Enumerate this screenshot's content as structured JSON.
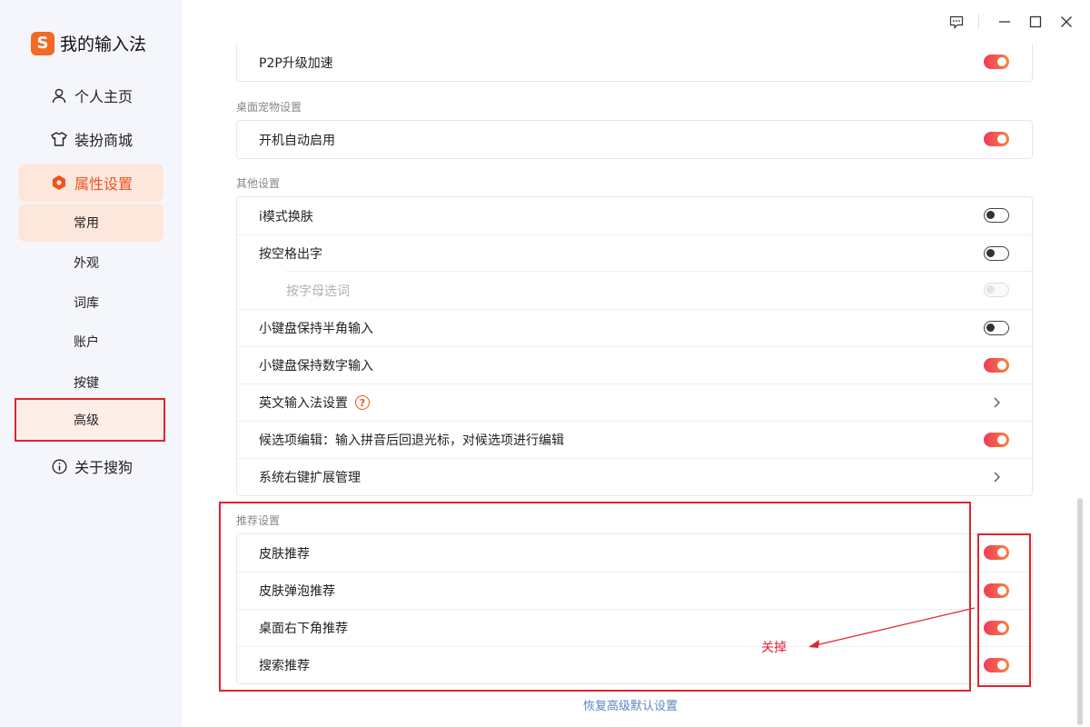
{
  "app": {
    "title": "我的输入法",
    "logo_letter": "S",
    "accent": "#f0521e"
  },
  "sidebar": {
    "nav": [
      {
        "label": "个人主页",
        "icon": "person-icon"
      },
      {
        "label": "装扮商城",
        "icon": "shirt-icon"
      },
      {
        "label": "属性设置",
        "icon": "hexagon-settings-icon"
      }
    ],
    "sub_items": [
      "常用",
      "外观",
      "词库",
      "账户",
      "按键",
      "高级"
    ],
    "about": {
      "label": "关于搜狗",
      "icon": "info-icon"
    }
  },
  "sections": {
    "p2p": {
      "label": "P2P升级加速",
      "on": true
    },
    "pet": {
      "title": "桌面宠物设置",
      "row": {
        "label": "开机自动启用",
        "on": true
      }
    },
    "other": {
      "title": "其他设置",
      "rows": [
        {
          "label": "i模式换肤",
          "state": "off"
        },
        {
          "label": "按空格出字",
          "state": "off"
        },
        {
          "label": "按字母选词",
          "state": "disabled"
        },
        {
          "label": "小键盘保持半角输入",
          "state": "off"
        },
        {
          "label": "小键盘保持数字输入",
          "state": "on"
        },
        {
          "label": "英文输入法设置",
          "state": "link"
        },
        {
          "label": "候选项编辑：输入拼音后回退光标，对候选项进行编辑",
          "state": "on"
        },
        {
          "label": "系统右键扩展管理",
          "state": "link"
        }
      ]
    },
    "recommend": {
      "title": "推荐设置",
      "rows": [
        {
          "label": "皮肤推荐",
          "on": true
        },
        {
          "label": "皮肤弹泡推荐",
          "on": true
        },
        {
          "label": "桌面右下角推荐",
          "on": true
        },
        {
          "label": "搜索推荐",
          "on": true
        }
      ]
    }
  },
  "reset_label": "恢复高级默认设置",
  "annotation": {
    "text": "关掉",
    "color": "#e0242f"
  }
}
